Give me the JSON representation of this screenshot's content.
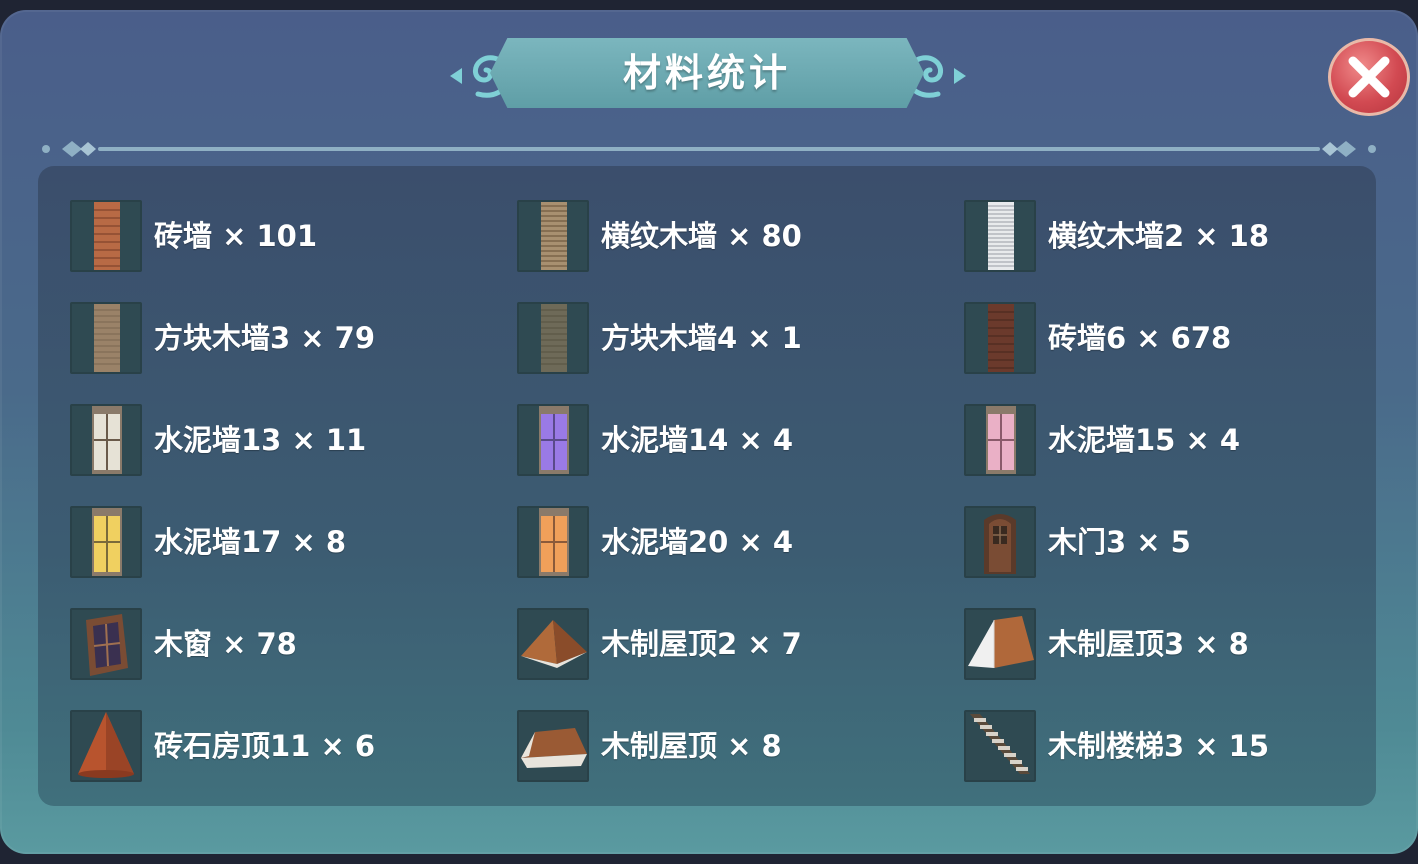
{
  "header": {
    "title": "材料统计"
  },
  "colors": {
    "panel_top": "#4a5e8a",
    "panel_bottom": "#5a9aa0",
    "banner": "#6aa8b0",
    "close_red": "#d24a52"
  },
  "close_button": {
    "icon": "close-icon"
  },
  "items": [
    {
      "label": "砖墙 × 101",
      "icon": "brick-wall-icon"
    },
    {
      "label": "横纹木墙 × 80",
      "icon": "horizontal-wood-wall-icon"
    },
    {
      "label": "横纹木墙2 × 18",
      "icon": "white-plank-wall-icon"
    },
    {
      "label": "方块木墙3 × 79",
      "icon": "block-wood-wall-icon"
    },
    {
      "label": "方块木墙4 × 1",
      "icon": "dark-wood-wall-icon"
    },
    {
      "label": "砖墙6 × 678",
      "icon": "dark-brick-wall-icon"
    },
    {
      "label": "水泥墙13 × 11",
      "icon": "white-window-wall-icon"
    },
    {
      "label": "水泥墙14 × 4",
      "icon": "purple-window-wall-icon"
    },
    {
      "label": "水泥墙15 × 4",
      "icon": "pink-window-wall-icon"
    },
    {
      "label": "水泥墙17 × 8",
      "icon": "yellow-window-wall-icon"
    },
    {
      "label": "水泥墙20 × 4",
      "icon": "orange-window-wall-icon"
    },
    {
      "label": "木门3 × 5",
      "icon": "wooden-door-icon"
    },
    {
      "label": "木窗 × 78",
      "icon": "wooden-window-icon"
    },
    {
      "label": "木制屋顶2 × 7",
      "icon": "pyramid-roof-icon"
    },
    {
      "label": "木制屋顶3 × 8",
      "icon": "gable-roof-icon"
    },
    {
      "label": "砖石房顶11 × 6",
      "icon": "cone-roof-icon"
    },
    {
      "label": "木制屋顶 × 8",
      "icon": "flat-roof-icon"
    },
    {
      "label": "木制楼梯3 × 15",
      "icon": "wooden-stairs-icon"
    }
  ]
}
